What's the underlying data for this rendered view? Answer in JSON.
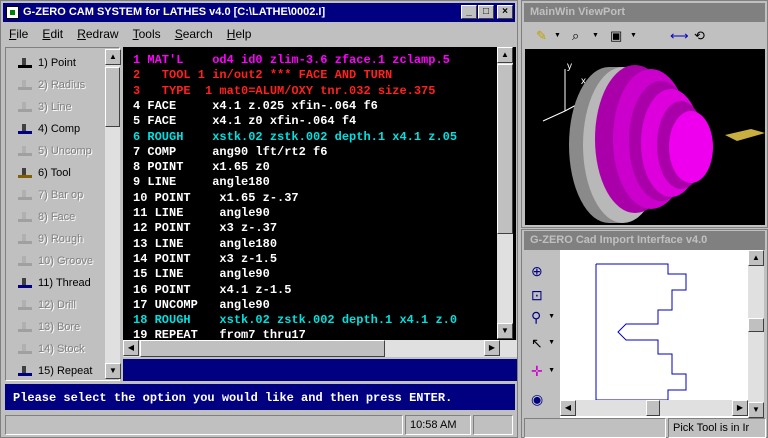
{
  "main_window": {
    "title": "G-ZERO CAM SYSTEM for LATHES v4.0  [C:\\LATHE\\0002.I]",
    "controls": {
      "minimize": "_",
      "maximize": "□",
      "close": "×"
    }
  },
  "menu": [
    {
      "pre": "",
      "u": "F",
      "post": "ile"
    },
    {
      "pre": "",
      "u": "E",
      "post": "dit"
    },
    {
      "pre": "",
      "u": "R",
      "post": "edraw"
    },
    {
      "pre": "",
      "u": "T",
      "post": "ools"
    },
    {
      "pre": "",
      "u": "S",
      "post": "earch"
    },
    {
      "pre": "",
      "u": "H",
      "post": "elp"
    }
  ],
  "tools": [
    {
      "label": "1) Point",
      "enabled": true,
      "icon": "point-icon"
    },
    {
      "label": "2) Radius",
      "enabled": false,
      "icon": "radius-icon"
    },
    {
      "label": "3) Line",
      "enabled": false,
      "icon": "line-icon"
    },
    {
      "label": "4) Comp",
      "enabled": true,
      "icon": "comp-icon"
    },
    {
      "label": "5) Uncomp",
      "enabled": false,
      "icon": "uncomp-icon"
    },
    {
      "label": "6) Tool",
      "enabled": true,
      "icon": "tool-icon"
    },
    {
      "label": "7) Bar op",
      "enabled": false,
      "icon": "bar-op-icon"
    },
    {
      "label": "8) Face",
      "enabled": false,
      "icon": "face-icon"
    },
    {
      "label": "9) Rough",
      "enabled": false,
      "icon": "rough-icon"
    },
    {
      "label": "10) Groove",
      "enabled": false,
      "icon": "groove-icon"
    },
    {
      "label": "11) Thread",
      "enabled": true,
      "icon": "thread-icon"
    },
    {
      "label": "12) Drill",
      "enabled": false,
      "icon": "drill-icon"
    },
    {
      "label": "13) Bore",
      "enabled": false,
      "icon": "bore-icon"
    },
    {
      "label": "14) Stock",
      "enabled": false,
      "icon": "stock-icon"
    },
    {
      "label": "15) Repeat",
      "enabled": true,
      "icon": "repeat-icon"
    }
  ],
  "code_lines": [
    {
      "text": "1 MAT'L    od4 id0 zlim-3.6 zface.1 zclamp.5",
      "color": "#ff00ff"
    },
    {
      "text": "2   TOOL 1 in/out2 *** FACE AND TURN",
      "color": "#ff2020"
    },
    {
      "text": "3   TYPE  1 mat0=ALUM/OXY tnr.032 size.375",
      "color": "#ff2020"
    },
    {
      "text": "4 FACE     x4.1 z.025 xfin-.064 f6",
      "color": "#ffffff"
    },
    {
      "text": "5 FACE     x4.1 z0 xfin-.064 f4",
      "color": "#ffffff"
    },
    {
      "text": "6 ROUGH    xstk.02 zstk.002 depth.1 x4.1 z.05",
      "color": "#00e0e0"
    },
    {
      "text": "7 COMP     ang90 lft/rt2 f6",
      "color": "#ffffff"
    },
    {
      "text": "8 POINT    x1.65 z0",
      "color": "#ffffff"
    },
    {
      "text": "9 LINE     angle180",
      "color": "#ffffff"
    },
    {
      "text": "10 POINT    x1.65 z-.37",
      "color": "#ffffff"
    },
    {
      "text": "11 LINE     angle90",
      "color": "#ffffff"
    },
    {
      "text": "12 POINT    x3 z-.37",
      "color": "#ffffff"
    },
    {
      "text": "13 LINE     angle180",
      "color": "#ffffff"
    },
    {
      "text": "14 POINT    x3 z-1.5",
      "color": "#ffffff"
    },
    {
      "text": "15 LINE     angle90",
      "color": "#ffffff"
    },
    {
      "text": "16 POINT    x4.1 z-1.5",
      "color": "#ffffff"
    },
    {
      "text": "17 UNCOMP   angle90",
      "color": "#ffffff"
    },
    {
      "text": "18 ROUGH    xstk.02 zstk.002 depth.1 x4.1 z.0",
      "color": "#00e0e0"
    },
    {
      "text": "19 REPEAT   from7 thru17",
      "color": "#ffffff"
    }
  ],
  "prompt": "Please select the option you would like and then press ENTER.",
  "status": {
    "time": "10:58 AM"
  },
  "viewport_window": {
    "title": "MainWin ViewPort",
    "axis_labels": {
      "x": "x",
      "y": "y"
    }
  },
  "cad_window": {
    "title": "G-ZERO Cad Import Interface v4.0",
    "status": "Pick Tool is in Ir"
  },
  "colors": {
    "title_active": "#000080",
    "title_inactive": "#808080",
    "part_magenta": "#cc00cc",
    "cad_outline": "#0000c0"
  }
}
